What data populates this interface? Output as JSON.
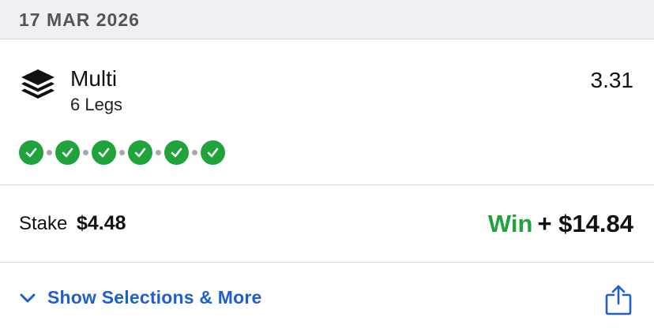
{
  "date_header": {
    "text": "17 MAR 2026"
  },
  "bet": {
    "type_icon": "layers-icon",
    "type": "Multi",
    "legs_text": "6 Legs",
    "odds": "3.31",
    "legs": [
      {
        "status": "won",
        "icon": "check-icon"
      },
      {
        "status": "won",
        "icon": "check-icon"
      },
      {
        "status": "won",
        "icon": "check-icon"
      },
      {
        "status": "won",
        "icon": "check-icon"
      },
      {
        "status": "won",
        "icon": "check-icon"
      },
      {
        "status": "won",
        "icon": "check-icon"
      }
    ],
    "stake_label": "Stake",
    "stake_value": "$4.48",
    "result_label": "Win",
    "result_amount": "+ $14.84"
  },
  "footer": {
    "show_more_label": "Show Selections & More",
    "chevron_icon": "chevron-down-icon",
    "share_icon": "share-icon"
  },
  "colors": {
    "header_bg": "#efeff4",
    "win_green": "#1fa33a",
    "link_blue": "#1d5fd0",
    "divider": "#d9d9dc"
  }
}
